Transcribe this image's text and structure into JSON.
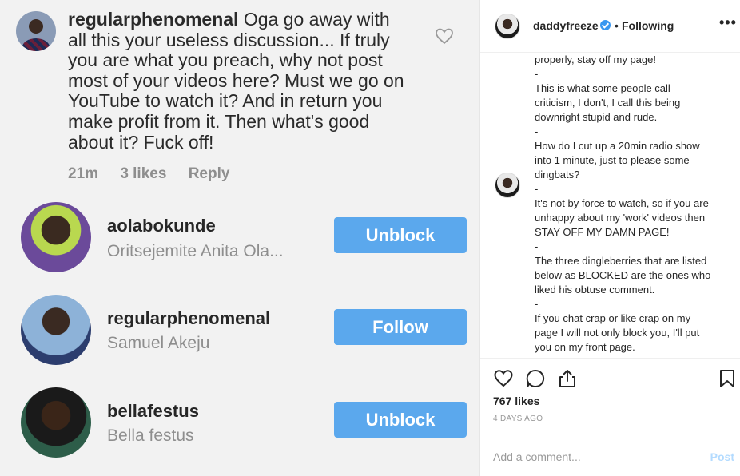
{
  "left_panel": {
    "comment": {
      "username": "regularphenomenal",
      "text": "Oga go away with all this your useless discussion... If truly you are what you preach, why not post most of your videos here?  Must we go on YouTube to watch it?  And in return you make profit from it. Then what's good about it?  Fuck off!",
      "time": "21m",
      "likes": "3 likes",
      "reply": "Reply"
    },
    "users": [
      {
        "username": "aolabokunde",
        "fullname": "Oritsejemite Anita Ola...",
        "button": "Unblock"
      },
      {
        "username": "regularphenomenal",
        "fullname": "Samuel Akeju",
        "button": "Follow"
      },
      {
        "username": "bellafestus",
        "fullname": "Bella festus",
        "button": "Unblock"
      }
    ]
  },
  "post": {
    "header": {
      "username": "daddyfreeze",
      "separator": "•",
      "following": "Following",
      "more": "•••"
    },
    "caption_lines": [
      "properly, stay off my page!",
      "-",
      "This is what some people call",
      "criticism, I don't, I call this being",
      "downright stupid and rude.",
      "-",
      "How do I cut up a 20min radio show",
      "into 1 minute, just to please some",
      "dingbats?",
      "-",
      "It's not by force to watch, so if you are",
      "unhappy about my 'work' videos then",
      "STAY OFF MY DAMN PAGE!",
      "-",
      "The three dingleberries that are listed",
      "below as BLOCKED are the ones who",
      "liked his obtuse comment.",
      "-",
      "If you chat crap or like crap on my",
      "page I will not only block you, I'll put",
      "you on my front page."
    ],
    "likes": "767 likes",
    "time_ago": "4 DAYS AGO",
    "comment_placeholder": "Add a comment...",
    "post_label": "Post"
  },
  "icons": [
    "heart-icon",
    "comment-icon",
    "share-icon",
    "bookmark-icon",
    "verified-icon",
    "more-icon"
  ],
  "colors": {
    "button_blue": "#5ba8ed",
    "verified_blue": "#3897f0",
    "post_disabled": "#b3dbff"
  }
}
